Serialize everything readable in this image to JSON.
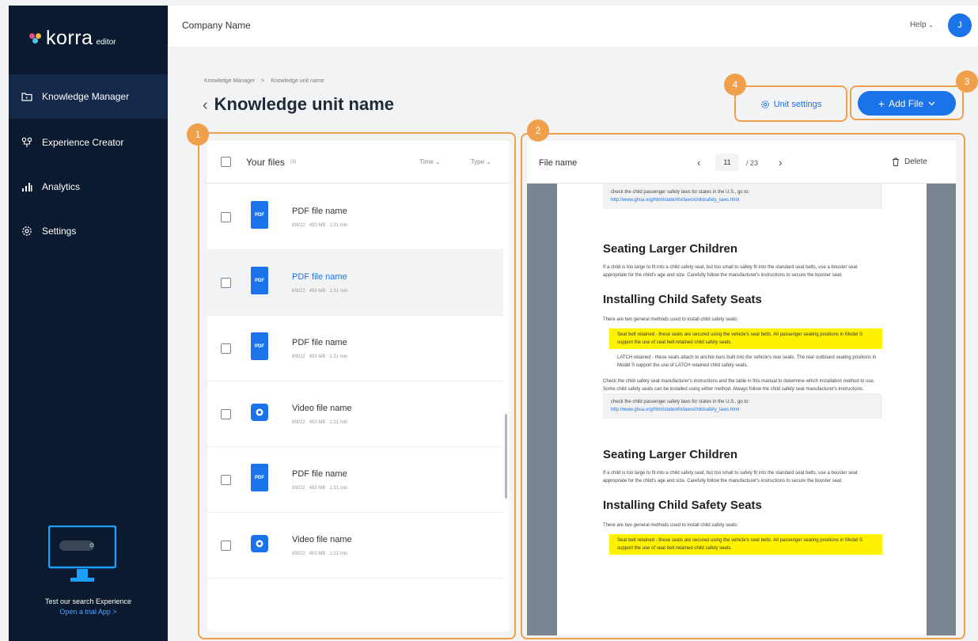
{
  "app": {
    "logo_text": "korra",
    "logo_sub": "editor"
  },
  "sidebar": {
    "items": [
      {
        "label": "Knowledge Manager",
        "icon": "folder-icon",
        "active": true
      },
      {
        "label": "Experience Creator",
        "icon": "nodes-icon",
        "active": false
      },
      {
        "label": "Analytics",
        "icon": "bar-chart-icon",
        "active": false
      },
      {
        "label": "Settings",
        "icon": "gear-icon",
        "active": false
      }
    ],
    "promo": {
      "text": "Test our search Experience",
      "link": "Open a trial App >"
    }
  },
  "topbar": {
    "company": "Company Name",
    "help": "Help",
    "avatar": "J"
  },
  "breadcrumb": {
    "items": [
      "Knowledge Manager",
      "Knowledge unit name"
    ],
    "separator": ">"
  },
  "page": {
    "title": "Knowledge unit name"
  },
  "actions": {
    "unit_settings": "Unit settings",
    "add_file": "Add File"
  },
  "annotations": [
    "1",
    "2",
    "3",
    "4"
  ],
  "files": {
    "header": "Your files",
    "count": "(3)",
    "sort_time": "Time",
    "sort_type": "Type",
    "rows": [
      {
        "name": "PDF file name",
        "date": "8/8/22",
        "size": "493 MB",
        "duration": "1:31 min",
        "type": "pdf",
        "selected": false
      },
      {
        "name": "PDF file name",
        "date": "8/8/22",
        "size": "493 MB",
        "duration": "1:31 min",
        "type": "pdf",
        "selected": true
      },
      {
        "name": "PDF file name",
        "date": "8/8/22",
        "size": "493 MB",
        "duration": "1:31 min",
        "type": "pdf",
        "selected": false
      },
      {
        "name": "Video file name",
        "date": "8/8/22",
        "size": "493 MB",
        "duration": "1:31 min",
        "type": "video",
        "selected": false
      },
      {
        "name": "PDF file name",
        "date": "8/8/22",
        "size": "493 MB",
        "duration": "1:31 min",
        "type": "pdf",
        "selected": false
      },
      {
        "name": "Video file name",
        "date": "8/8/22",
        "size": "493 MB",
        "duration": "1:31 min",
        "type": "video",
        "selected": false
      }
    ]
  },
  "viewer": {
    "file_name": "File name",
    "page": "11",
    "total": "/ 23",
    "delete": "Delete",
    "doc": {
      "box_text": "check the child passenger safety laws for states in the U.S., go to:",
      "box_link": "http://www.ghsa.org/html/stateinfo/laws/childsafety_laws.html",
      "h1": "Seating Larger Children",
      "p1": "If a child is too large to fit into a child safety seat, but too small to safely fit into the standard seat belts, use a booster seat appropriate for the child's age and size. Carefully follow the manufacturer's instructions to secure the booster seat.",
      "h2": "Installing Child Safety Seats",
      "p2": "There are two general methods used to install child safety seats:",
      "hl": "Seat belt retained - these seats are secured using the vehicle's seat belts. All passenger seating positions in Model S support the use of seat belt retained child safety seats.",
      "bullet": "LATCH retained - these seats attach to anchor bars built into the vehicle's rear seats. The rear outboard seating positions in Model S support the use of LATCH retained child safety seats.",
      "p3": "Check the child safety seat manufacturer's instructions and the table in this manual to determine which installation method to use. Some child safety seats can be installed using either method. Always follow the child safety seat manufacturer's instructions."
    }
  },
  "colors": {
    "primary": "#1a73e8",
    "sidebar_bg": "#0b1a2e",
    "annotation": "#f0a04b",
    "highlight": "#fff200"
  }
}
